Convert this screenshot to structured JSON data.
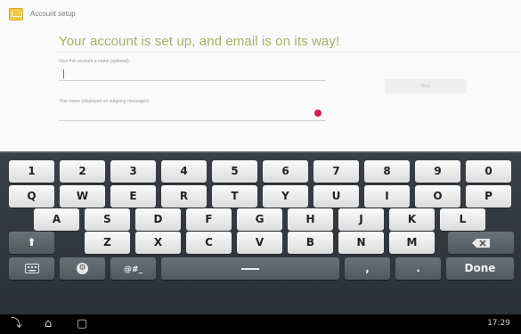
{
  "title_bar": {
    "title": "Account setup"
  },
  "headline": "Your account is set up, and email is on its way!",
  "fields": [
    {
      "label": "Give this account a name (optional)",
      "value": ""
    },
    {
      "label": "Your name (displayed on outgoing messages)",
      "value": ""
    }
  ],
  "next_button": {
    "label": "Next"
  },
  "keyboard": {
    "rows": [
      [
        "1",
        "2",
        "3",
        "4",
        "5",
        "6",
        "7",
        "8",
        "9",
        "0"
      ],
      [
        "Q",
        "W",
        "E",
        "R",
        "T",
        "Y",
        "U",
        "I",
        "O",
        "P"
      ],
      [
        "A",
        "S",
        "D",
        "F",
        "G",
        "H",
        "J",
        "K",
        "L"
      ],
      [
        "Z",
        "X",
        "C",
        "V",
        "B",
        "N",
        "M"
      ]
    ],
    "symbols_label": "@#_",
    "done_label": "Done",
    "comma": ",",
    "period": "."
  },
  "status_bar": {
    "time": "17:29"
  },
  "icons": {
    "app": "email-app-icon",
    "shift": "shift-icon",
    "backspace": "backspace-icon",
    "keyboard_switch": "keyboard-switch-icon",
    "settings": "settings-key-icon",
    "back": "back-icon",
    "home": "home-icon",
    "recent": "recent-apps-icon"
  },
  "colors": {
    "headline": "#a2b36a",
    "error": "#d81b4e",
    "keyboard_bg": "#33383e"
  }
}
